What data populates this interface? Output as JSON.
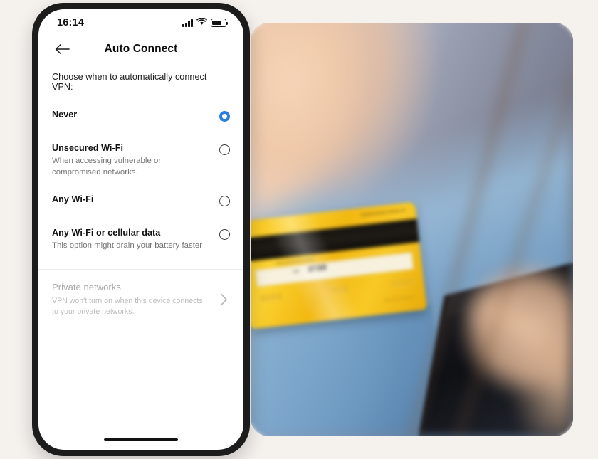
{
  "background_color": "#f5f2ee",
  "phone": {
    "status_bar": {
      "time": "16:14",
      "icons": [
        "signal-bars-icon",
        "wifi-icon",
        "battery-icon"
      ]
    },
    "nav": {
      "back_icon": "back-arrow-icon",
      "title": "Auto Connect"
    },
    "intro_text": "Choose when to automatically connect VPN:",
    "accent_color": "#2a7de1",
    "options": [
      {
        "title": "Never",
        "subtitle": "",
        "selected": true
      },
      {
        "title": "Unsecured Wi-Fi",
        "subtitle": "When accessing vulnerable or compromised networks.",
        "selected": false
      },
      {
        "title": "Any Wi-Fi",
        "subtitle": "",
        "selected": false
      },
      {
        "title": "Any Wi-Fi or cellular data",
        "subtitle": "This option might drain your battery faster",
        "selected": false
      }
    ],
    "private_networks": {
      "title": "Private networks",
      "subtitle": "VPN won't turn on when this device connects to your private networks.",
      "chevron_icon": "chevron-right-icon",
      "disabled": true
    }
  },
  "photo": {
    "description": "Mirrored photo of a person in a blue denim shirt holding a dark smartphone in one hand and a yellow bank card in the other",
    "card": {
      "assistance_text": "24 HOUR ASSISTANCE",
      "website_text": "WWW.XXXXXXXX.XXX",
      "cvv": "9876",
      "cvv_label": "123",
      "number_groups": [
        "5123",
        "8107",
        "0450"
      ],
      "cardholder": "KKKKKK",
      "card_color": "#f4c01c"
    }
  }
}
